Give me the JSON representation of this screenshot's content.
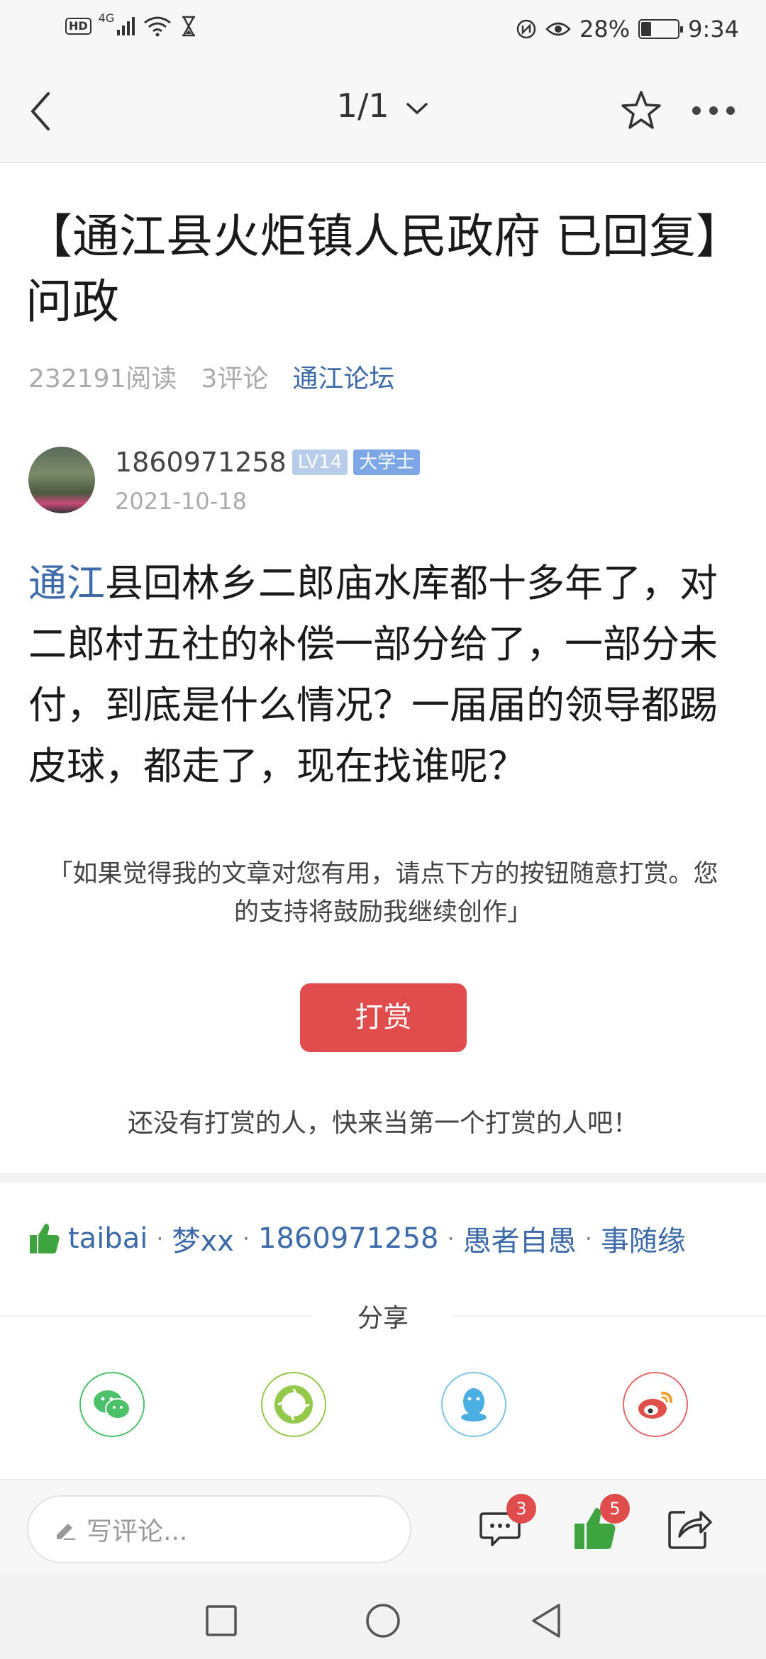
{
  "status_bar": {
    "hd": "HD",
    "network": "4G",
    "battery_percent_label": "28%",
    "battery_level": 0.28,
    "time": "9:34",
    "icons": [
      "hd-icon",
      "signal-icon",
      "wifi-icon",
      "hourglass-icon",
      "nfc-icon",
      "eye-comfort-icon",
      "battery-icon"
    ]
  },
  "nav": {
    "page_indicator": "1/1",
    "icons": [
      "back-arrow-icon",
      "chevron-down-icon",
      "star-icon",
      "more-dots-icon"
    ]
  },
  "article": {
    "title": "【通江县火炬镇人民政府 已回复】问政",
    "reads": "232191阅读",
    "comments": "3评论",
    "forum": "通江论坛",
    "author": {
      "name": "1860971258",
      "level": "LV14",
      "rank": "大学士",
      "date": "2021-10-18"
    },
    "body_link": "通江",
    "body_text": "县回林乡二郎庙水库都十多年了，对二郎村五社的补偿一部分给了，一部分未付，到底是什么情况？一届届的领导都踢皮球，都走了，现在找谁呢？"
  },
  "reward": {
    "note": "「如果觉得我的文章对您有用，请点下方的按钮随意打赏。您的支持将鼓励我继续创作」",
    "button_label": "打赏",
    "empty_text": "还没有打赏的人，快来当第一个打赏的人吧！"
  },
  "likes": {
    "users": [
      "taibai",
      "梦xx",
      "1860971258",
      "愚者自愚",
      "事随缘"
    ],
    "separator": "·"
  },
  "share": {
    "label": "分享",
    "targets": [
      "wechat-icon",
      "moments-icon",
      "qq-icon",
      "weibo-icon"
    ]
  },
  "bottom_bar": {
    "comment_placeholder": "写评论...",
    "comment_count": "3",
    "like_count": "5"
  },
  "colors": {
    "link": "#3d6aa8",
    "reward_button": "#e04b4b",
    "like_green": "#3fa43f"
  }
}
